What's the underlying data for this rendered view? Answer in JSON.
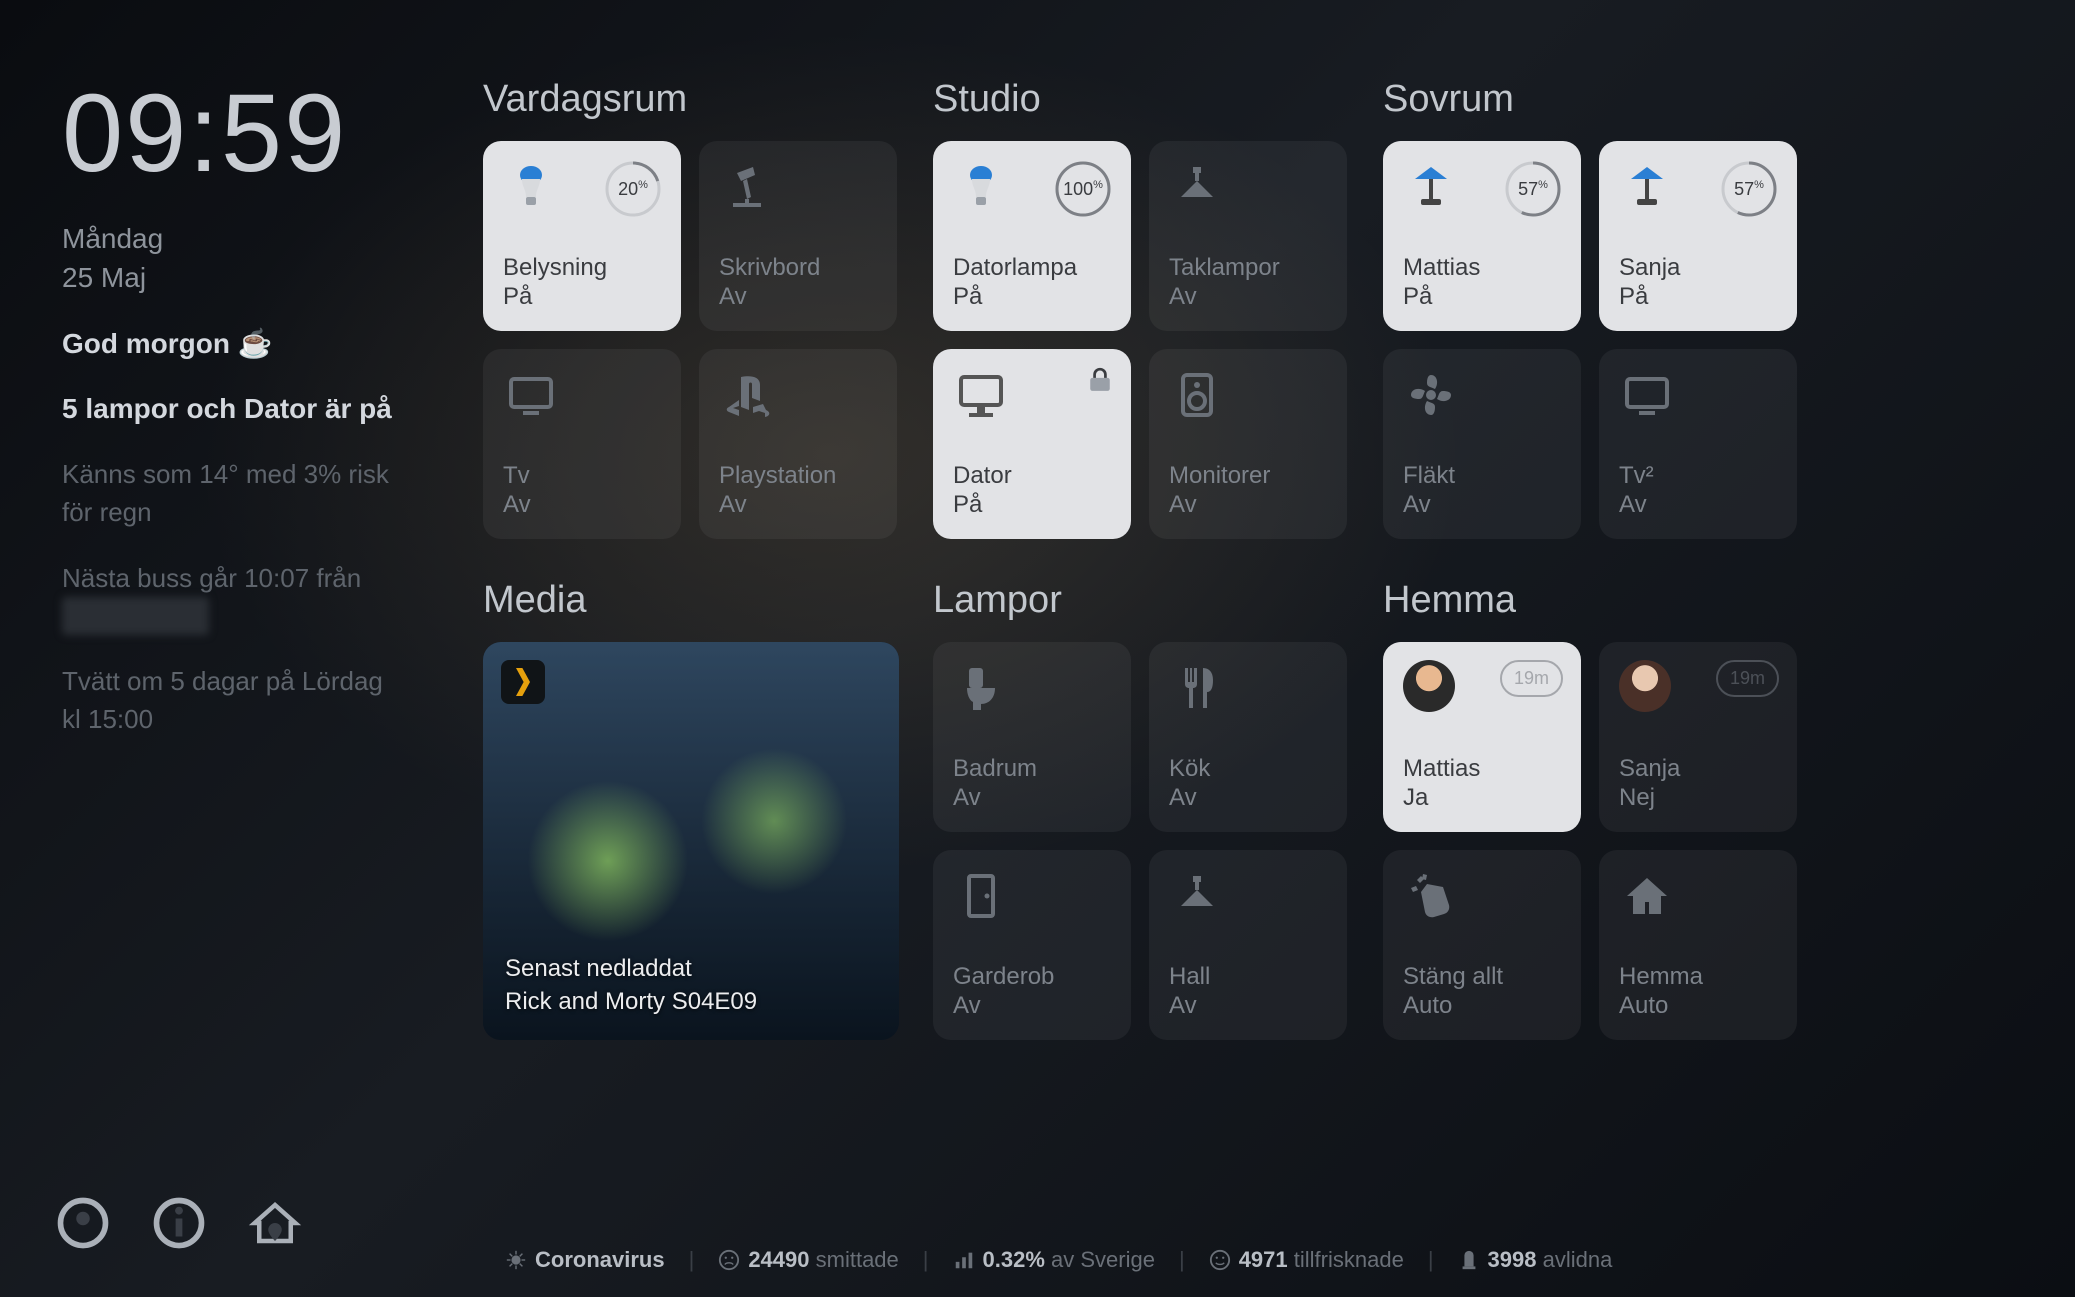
{
  "sidebar": {
    "clock": "09:59",
    "date_line1": "Måndag",
    "date_line2": "25 Maj",
    "greeting": "God morgon ☕",
    "status": "5 lampor och Dator är på",
    "weather": "Känns som 14° med 3% risk för regn",
    "bus": "Nästa buss går 10:07 från ",
    "bus_redacted": "████████",
    "laundry": "Tvätt om 5 dagar på Lördag kl 15:00"
  },
  "rooms": {
    "vardagsrum": {
      "title": "Vardagsrum",
      "tiles": [
        {
          "name": "Belysning",
          "state": "På",
          "icon": "bulb",
          "on": true,
          "pct": "20"
        },
        {
          "name": "Skrivbord",
          "state": "Av",
          "icon": "desk-lamp",
          "on": false
        },
        {
          "name": "Tv",
          "state": "Av",
          "icon": "tv",
          "on": false
        },
        {
          "name": "Playstation",
          "state": "Av",
          "icon": "playstation",
          "on": false
        }
      ]
    },
    "studio": {
      "title": "Studio",
      "tiles": [
        {
          "name": "Datorlampa",
          "state": "På",
          "icon": "bulb",
          "on": true,
          "pct": "100"
        },
        {
          "name": "Taklampor",
          "state": "Av",
          "icon": "ceiling",
          "on": false
        },
        {
          "name": "Dator",
          "state": "På",
          "icon": "computer",
          "on": true,
          "locked": true
        },
        {
          "name": "Monitorer",
          "state": "Av",
          "icon": "speaker",
          "on": false
        }
      ]
    },
    "sovrum": {
      "title": "Sovrum",
      "tiles": [
        {
          "name": "Mattias",
          "state": "På",
          "icon": "bed-lamp",
          "on": true,
          "pct": "57"
        },
        {
          "name": "Sanja",
          "state": "På",
          "icon": "bed-lamp",
          "on": true,
          "pct": "57"
        },
        {
          "name": "Fläkt",
          "state": "Av",
          "icon": "fan",
          "on": false
        },
        {
          "name": "Tv²",
          "state": "Av",
          "icon": "tv",
          "on": false
        }
      ]
    },
    "lampor": {
      "title": "Lampor",
      "tiles": [
        {
          "name": "Badrum",
          "state": "Av",
          "icon": "toilet",
          "on": false
        },
        {
          "name": "Kök",
          "state": "Av",
          "icon": "cutlery",
          "on": false
        },
        {
          "name": "Garderob",
          "state": "Av",
          "icon": "door",
          "on": false
        },
        {
          "name": "Hall",
          "state": "Av",
          "icon": "ceiling",
          "on": false
        }
      ]
    },
    "hemma": {
      "title": "Hemma",
      "tiles": [
        {
          "name": "Mattias",
          "state": "Ja",
          "icon": "avatar1",
          "on": true,
          "badge": "19m"
        },
        {
          "name": "Sanja",
          "state": "Nej",
          "icon": "avatar2",
          "on": false,
          "badge": "19m"
        },
        {
          "name": "Stäng allt",
          "state": "Auto",
          "icon": "clap",
          "on": false
        },
        {
          "name": "Hemma",
          "state": "Auto",
          "icon": "home",
          "on": false
        }
      ]
    }
  },
  "media": {
    "title": "Media",
    "caption_l1": "Senast nedladdat",
    "caption_l2": "Rick and Morty S04E09"
  },
  "footer": {
    "label": "Coronavirus",
    "infected_n": "24490",
    "infected_t": "smittade",
    "pct_n": "0.32%",
    "pct_t": "av Sverige",
    "recovered_n": "4971",
    "recovered_t": "tillfrisknade",
    "dead_n": "3998",
    "dead_t": "avlidna"
  }
}
